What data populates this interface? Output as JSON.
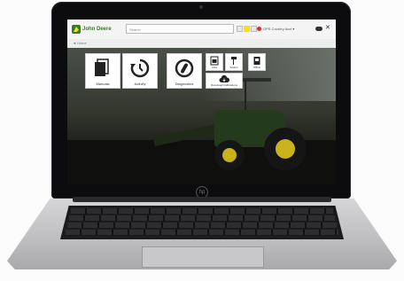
{
  "app": {
    "brand": "John Deere",
    "search_placeholder": "Search",
    "account_text": "OPS Country Acct ▾",
    "breadcrumb": "◄ Home"
  },
  "tiles": [
    {
      "label": "Manuals",
      "icon": "manuals-icon"
    },
    {
      "label": "Activity",
      "icon": "activity-icon"
    },
    {
      "label": "Diagnostics",
      "icon": "diagnostics-icon"
    },
    {
      "label": "Jobs",
      "icon": "jobs-icon"
    },
    {
      "label": "Station",
      "icon": "station-icon"
    },
    {
      "label": "Offline",
      "icon": "offline-icon"
    },
    {
      "label": "Download Calibrations",
      "icon": "cloud-download-icon"
    }
  ],
  "colors": {
    "brand_green": "#367c2b",
    "brand_yellow": "#ffde00"
  },
  "device": {
    "logo": "hp"
  }
}
